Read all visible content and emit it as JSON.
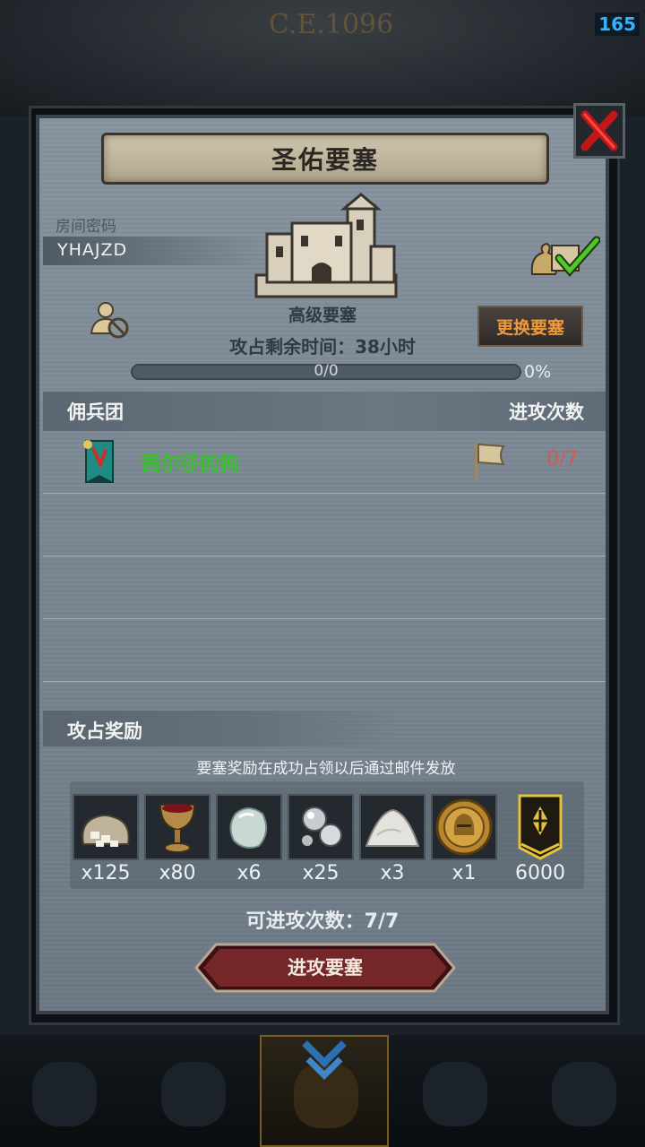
{
  "hud": {
    "fps": "165",
    "year": "C.E.1096"
  },
  "dialog": {
    "title": "圣佑要塞",
    "room_label": "房间密码",
    "room_code": "YHAJZD",
    "fortress_level": "高级要塞",
    "time_left": "攻占剩余时间：38小时",
    "change_button": "更换要塞",
    "progress_text": "0/0",
    "progress_percent_label": "0%",
    "progress_fraction": 0,
    "list_header": {
      "left": "佣兵团",
      "right": "进攻次数"
    },
    "guilds": [
      {
        "name": "茜尔莎的狗",
        "attacks": "0/7"
      }
    ],
    "reward_title": "攻占奖励",
    "reward_note": "要塞奖励在成功占领以后通过邮件发放",
    "rewards": [
      {
        "icon": "ore-sack-icon",
        "qty": "x125"
      },
      {
        "icon": "goblet-icon",
        "qty": "x80"
      },
      {
        "icon": "gem-stone-icon",
        "qty": "x6"
      },
      {
        "icon": "silver-orbs-icon",
        "qty": "x25"
      },
      {
        "icon": "salt-pile-icon",
        "qty": "x3"
      },
      {
        "icon": "knight-medal-icon",
        "qty": "x1"
      },
      {
        "icon": "rank-banner-icon",
        "qty": "6000"
      }
    ],
    "attacks_available": "可进攻次数：7/7",
    "attack_button": "进攻要塞"
  },
  "colors": {
    "accent_orange": "#ef9a3a",
    "guild_green": "#36c12a",
    "count_red": "#d65852",
    "button_red": "#6e2424"
  }
}
